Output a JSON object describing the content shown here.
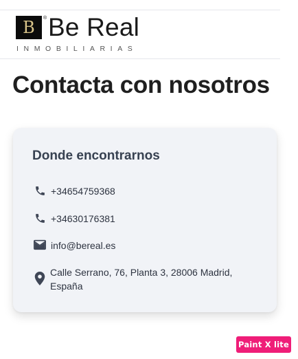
{
  "brand": {
    "logo_mark": "B",
    "registered": "®",
    "name": "Be Real",
    "tagline": "INMOBILIARIAS"
  },
  "page": {
    "title": "Contacta con nosotros"
  },
  "contact_card": {
    "title": "Donde encontrarnos",
    "phone_1": "+34654759368",
    "phone_2": "+34630176381",
    "email": "info@bereal.es",
    "address": "Calle Serrano, 76, Planta 3, 28006 Madrid, España",
    "icons": [
      "phone-icon",
      "phone-icon",
      "mail-icon",
      "map-pin-icon"
    ]
  },
  "watermark": {
    "label": "Paint X lite"
  },
  "colors": {
    "icon": "#3f4656",
    "card_background": "#f1f3f7",
    "watermark": "#ef1d78"
  }
}
